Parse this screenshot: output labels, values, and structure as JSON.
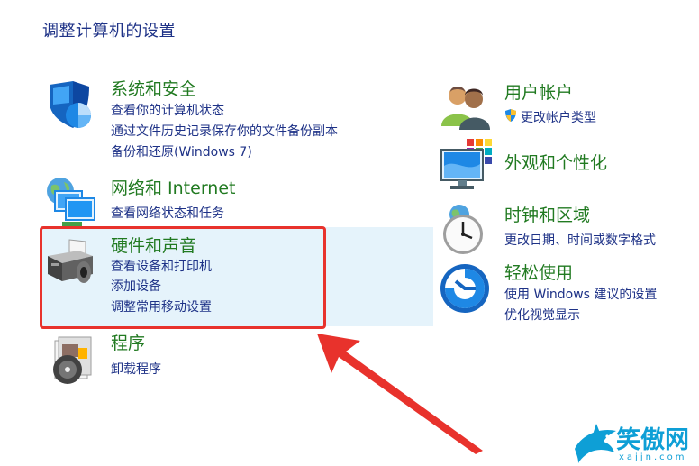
{
  "page_title": "调整计算机的设置",
  "left_categories": [
    {
      "id": "security",
      "title": "系统和安全",
      "links": [
        "查看你的计算机状态",
        "通过文件历史记录保存你的文件备份副本",
        "备份和还原(Windows 7)"
      ],
      "icon": "security-shield-icon"
    },
    {
      "id": "network",
      "title": "网络和 Internet",
      "links": [
        "查看网络状态和任务"
      ],
      "icon": "network-globe-icon"
    },
    {
      "id": "hardware",
      "title": "硬件和声音",
      "links": [
        "查看设备和打印机",
        "添加设备",
        "调整常用移动设置"
      ],
      "icon": "printer-icon"
    },
    {
      "id": "programs",
      "title": "程序",
      "links": [
        "卸载程序"
      ],
      "icon": "programs-disc-icon"
    }
  ],
  "right_categories": [
    {
      "id": "accounts",
      "title": "用户帐户",
      "links": [
        "更改帐户类型"
      ],
      "icon": "users-icon"
    },
    {
      "id": "appearance",
      "title": "外观和个性化",
      "links": [],
      "icon": "monitor-palette-icon"
    },
    {
      "id": "clock",
      "title": "时钟和区域",
      "links": [
        "更改日期、时间或数字格式"
      ],
      "icon": "clock-icon"
    },
    {
      "id": "ease",
      "title": "轻松使用",
      "links": [
        "使用 Windows 建议的设置",
        "优化视觉显示"
      ],
      "icon": "ease-of-access-icon"
    }
  ],
  "watermark": {
    "text": "笑傲网",
    "sub": "xajjn.com"
  },
  "colors": {
    "title_green": "#217a21",
    "link_blue": "#1e3287",
    "highlight_bg": "#e5f3fb",
    "annotation_red": "#e8322c"
  }
}
